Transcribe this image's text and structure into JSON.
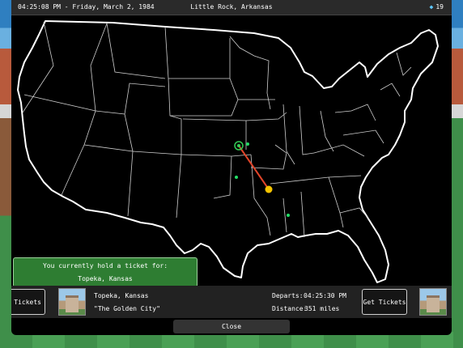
{
  "status_bar": {
    "time_date": "04:25:08 PM - Friday, March 2, 1984",
    "location": "Little Rock, Arkansas",
    "gem_count": "19",
    "gem_icon": "diamond-icon"
  },
  "ticket_panel": {
    "title": "You currently hold a ticket for:",
    "destination": "Topeka, Kansas"
  },
  "info_bar": {
    "prev_button_label": "t Tickets",
    "city_name": "Topeka, Kansas",
    "city_nickname": "\"The Golden City\"",
    "departs_label": "Departs:",
    "departs_time": "04:25:30 PM",
    "distance_label": "Distance:",
    "distance_value": "351 miles",
    "get_tickets_label": "Get Tickets"
  },
  "close_label": "Close",
  "colors": {
    "route_line": "#e0452a",
    "current_city": "#f5c400",
    "destination_marker": "#33cc55",
    "other_cities": "#22dd66",
    "panel_green": "#2e7d32"
  }
}
